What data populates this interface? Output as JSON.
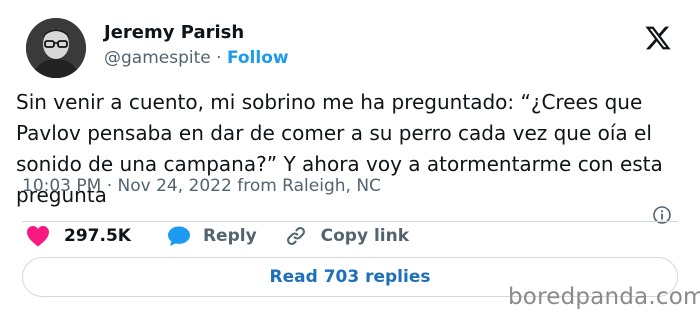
{
  "author": {
    "name": "Jeremy Parish",
    "handle": "@gamespite",
    "separator": "·",
    "follow_label": "Follow"
  },
  "tweet": {
    "text": "Sin venir a cuento, mi sobrino me ha preguntado: “¿Crees que Pavlov pensaba en dar de comer a su perro cada vez que oía el sonido de una campana?” Y ahora voy a atormentarme con esta pregunta",
    "timestamp": "10:03 PM · Nov 24, 2022 from Raleigh, NC"
  },
  "actions": {
    "likes": "297.5K",
    "reply_label": "Reply",
    "copy_link_label": "Copy link"
  },
  "replies_button": "Read 703 replies",
  "watermark": "boredpanda.com",
  "colors": {
    "accent": "#1d9bf0",
    "like": "#f91880",
    "text": "#0f1419",
    "muted": "#536471"
  },
  "icons": [
    "x-logo-icon",
    "info-icon",
    "heart-icon",
    "reply-bubble-icon",
    "link-icon"
  ]
}
